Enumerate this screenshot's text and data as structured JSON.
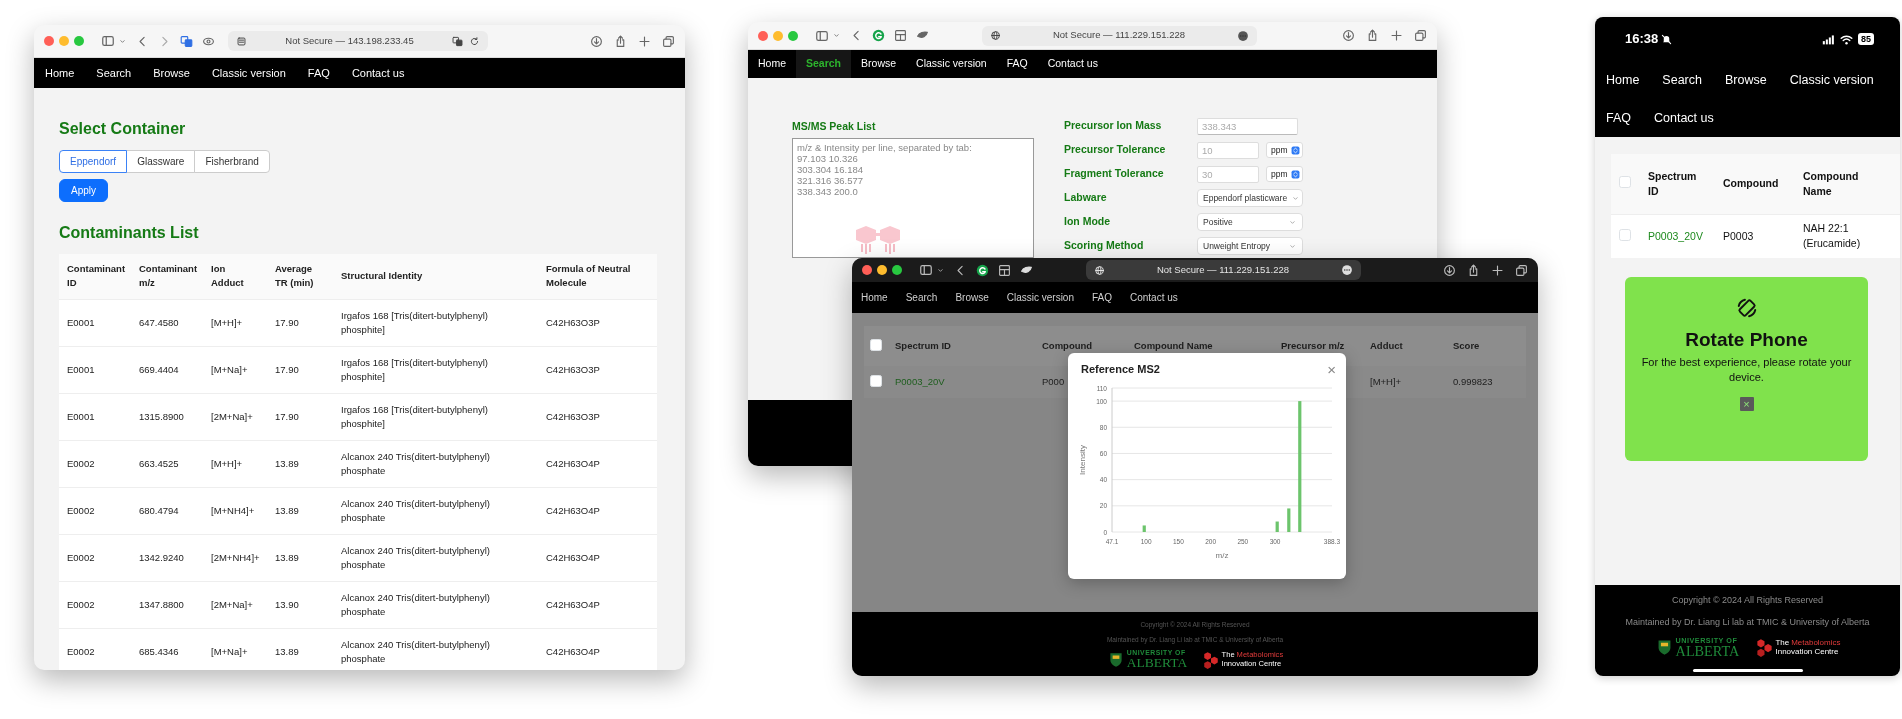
{
  "contaminants_window": {
    "address": "Not Secure — 143.198.233.45",
    "nav": [
      {
        "label": "Home",
        "selected": false
      },
      {
        "label": "Search",
        "selected": false
      },
      {
        "label": "Browse",
        "selected": false
      },
      {
        "label": "Classic version",
        "selected": false
      },
      {
        "label": "FAQ",
        "selected": false
      },
      {
        "label": "Contact us",
        "selected": false
      }
    ],
    "select_title": "Select Container",
    "containers": [
      {
        "label": "Eppendorf",
        "selected": true
      },
      {
        "label": "Glassware",
        "selected": false
      },
      {
        "label": "Fisherbrand",
        "selected": false
      }
    ],
    "apply": "Apply",
    "list_title": "Contaminants List",
    "table": {
      "columns": [
        "Contaminant ID",
        "Contaminant m/z",
        "Ion Adduct",
        "Average TR (min)",
        "Structural Identity",
        "Formula of Neutral Molecule"
      ],
      "rows": [
        [
          "E0001",
          "647.4580",
          "[M+H]+",
          "17.90",
          "Irgafos 168 [Tris(ditert-butylphenyl) phosphite]",
          "C42H63O3P"
        ],
        [
          "E0001",
          "669.4404",
          "[M+Na]+",
          "17.90",
          "Irgafos 168 [Tris(ditert-butylphenyl) phosphite]",
          "C42H63O3P"
        ],
        [
          "E0001",
          "1315.8900",
          "[2M+Na]+",
          "17.90",
          "Irgafos 168 [Tris(ditert-butylphenyl) phosphite]",
          "C42H63O3P"
        ],
        [
          "E0002",
          "663.4525",
          "[M+H]+",
          "13.89",
          "Alcanox 240 Tris(ditert-butylphenyl) phosphate",
          "C42H63O4P"
        ],
        [
          "E0002",
          "680.4794",
          "[M+NH4]+",
          "13.89",
          "Alcanox 240 Tris(ditert-butylphenyl) phosphate",
          "C42H63O4P"
        ],
        [
          "E0002",
          "1342.9240",
          "[2M+NH4]+",
          "13.89",
          "Alcanox 240 Tris(ditert-butylphenyl) phosphate",
          "C42H63O4P"
        ],
        [
          "E0002",
          "1347.8800",
          "[2M+Na]+",
          "13.90",
          "Alcanox 240 Tris(ditert-butylphenyl) phosphate",
          "C42H63O4P"
        ],
        [
          "E0002",
          "685.4346",
          "[M+Na]+",
          "13.89",
          "Alcanox 240 Tris(ditert-butylphenyl) phosphate",
          "C42H63O4P"
        ]
      ]
    }
  },
  "search_window": {
    "address": "Not Secure — 111.229.151.228",
    "nav": [
      {
        "label": "Home",
        "selected": false
      },
      {
        "label": "Search",
        "selected": true
      },
      {
        "label": "Browse",
        "selected": false
      },
      {
        "label": "Classic version",
        "selected": false
      },
      {
        "label": "FAQ",
        "selected": false
      },
      {
        "label": "Contact us",
        "selected": false
      }
    ],
    "peak_list": {
      "label": "MS/MS Peak List",
      "placeholder": "m/z & Intensity per line, separated by tab:\n97.103 10.326\n303.304 16.184\n321.316 36.577\n338.343 200.0"
    },
    "fields": [
      {
        "kind": "text",
        "label": "Precursor Ion Mass",
        "placeholder": "338.343"
      },
      {
        "kind": "unit",
        "label": "Precursor Tolerance",
        "placeholder": "10",
        "unit": "ppm"
      },
      {
        "kind": "unit",
        "label": "Fragment Tolerance",
        "placeholder": "30",
        "unit": "ppm"
      },
      {
        "kind": "select",
        "label": "Labware",
        "value": "Eppendorf plasticware"
      },
      {
        "kind": "select",
        "label": "Ion Mode",
        "value": "Positive"
      },
      {
        "kind": "select",
        "label": "Scoring Method",
        "value": "Unweight Entropy"
      }
    ]
  },
  "results_window": {
    "address": "Not Secure — 111.229.151.228",
    "nav": [
      {
        "label": "Home",
        "selected": false
      },
      {
        "label": "Search",
        "selected": false
      },
      {
        "label": "Browse",
        "selected": false
      },
      {
        "label": "Classic version",
        "selected": false
      },
      {
        "label": "FAQ",
        "selected": false
      },
      {
        "label": "Contact us",
        "selected": false
      }
    ],
    "table": {
      "header_checked": false,
      "columns": [
        "Spectrum ID",
        "Compound",
        "Compound Name",
        "Precursor m/z",
        "Adduct",
        "Score"
      ],
      "rows": [
        {
          "checked": false,
          "spectrum_id": "P0003_20V",
          "compound": "P000",
          "adduct": "[M+H]+",
          "score": "0.999823"
        }
      ]
    },
    "modal": {
      "title": "Reference MS2",
      "close": "×",
      "chart_data": {
        "type": "bar",
        "xlabel": "m/z",
        "ylabel": "Intensity",
        "x": [
          97.103,
          303.304,
          321.316,
          338.343
        ],
        "values": [
          5,
          8,
          18,
          100
        ],
        "grid": true,
        "xlim": [
          47.1,
          388.3
        ],
        "ylim": [
          0,
          110
        ],
        "xticks": [
          47.1,
          100,
          150,
          200,
          250,
          300,
          388.3
        ],
        "yticks": [
          0,
          20,
          40,
          60,
          80,
          100,
          110
        ]
      }
    },
    "footer": {
      "copyright": "Copyright © 2024 All Rights Reserved",
      "maintained": "Maintained by Dr. Liang Li lab at TMIC & University of Alberta",
      "logos": [
        {
          "kind": "ualberta",
          "top": "UNIVERSITY OF",
          "bottom": "ALBERTA"
        },
        {
          "kind": "tmic",
          "lead": "The",
          "accent": "Metabolomics",
          "bottom": "Innovation Centre"
        }
      ]
    }
  },
  "phone": {
    "time": "16:38",
    "battery": "85",
    "nav": [
      {
        "label": "Home",
        "selected": false
      },
      {
        "label": "Search",
        "selected": false
      },
      {
        "label": "Browse",
        "selected": false
      },
      {
        "label": "Classic version",
        "selected": false
      },
      {
        "label": "FAQ",
        "selected": false
      },
      {
        "label": "Contact us",
        "selected": false
      }
    ],
    "table": {
      "header_checked": false,
      "columns": [
        "Spectrum ID",
        "Compound",
        "Compound Name"
      ],
      "rows": [
        {
          "checked": false,
          "cells": [
            "P0003_20V",
            "P0003",
            "NAH 22:1 (Erucamide)"
          ]
        }
      ]
    },
    "notice": {
      "title": "Rotate Phone",
      "message": "For the best experience, please rotate your device.",
      "close": "×"
    },
    "footer": {
      "copyright": "Copyright © 2024 All Rights Reserved",
      "maintained": "Maintained by Dr. Liang Li lab at TMIC & University of Alberta",
      "logos": [
        {
          "kind": "ualberta",
          "top": "UNIVERSITY OF",
          "bottom": "ALBERTA"
        },
        {
          "kind": "tmic",
          "lead": "The",
          "accent": "Metabolomics",
          "bottom": "Innovation Centre"
        }
      ]
    }
  }
}
